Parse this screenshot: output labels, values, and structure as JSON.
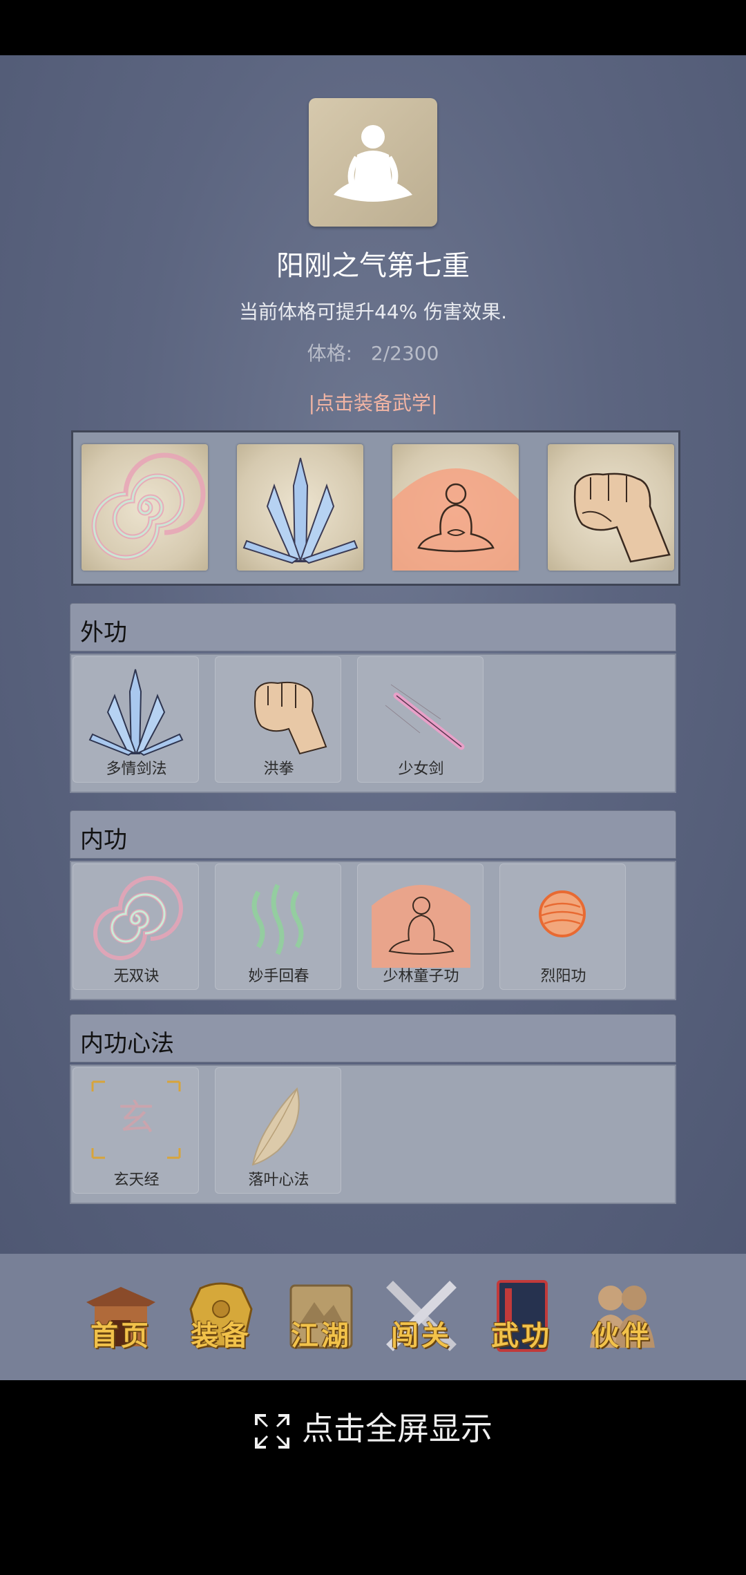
{
  "profile": {
    "title": "阳刚之气第七重",
    "description": "当前体格可提升44% 伤害效果.",
    "stat_label": "体格:",
    "stat_value": "2/2300",
    "equip_link": "|点击装备武学|"
  },
  "equipped_slots": [
    {
      "icon": "swirl-icon"
    },
    {
      "icon": "crystal-blades-icon"
    },
    {
      "icon": "meditating-monk-icon"
    },
    {
      "icon": "fist-icon"
    }
  ],
  "sections": [
    {
      "title": "外功",
      "items": [
        {
          "name": "多情剑法",
          "icon": "crystal-blades-icon"
        },
        {
          "name": "洪拳",
          "icon": "fist-icon"
        },
        {
          "name": "少女剑",
          "icon": "pink-sword-icon"
        }
      ]
    },
    {
      "title": "内功",
      "items": [
        {
          "name": "无双诀",
          "icon": "swirl-icon"
        },
        {
          "name": "妙手回春",
          "icon": "green-waves-icon"
        },
        {
          "name": "少林童子功",
          "icon": "meditating-monk-icon"
        },
        {
          "name": "烈阳功",
          "icon": "sun-orb-icon"
        }
      ]
    },
    {
      "title": "内功心法",
      "items": [
        {
          "name": "玄天经",
          "icon": "xuan-scroll-icon",
          "glyph": "玄"
        },
        {
          "name": "落叶心法",
          "icon": "leaf-icon"
        }
      ]
    }
  ],
  "nav": [
    {
      "label": "首页",
      "icon": "temple-icon"
    },
    {
      "label": "装备",
      "icon": "armor-icon"
    },
    {
      "label": "江湖",
      "icon": "scroll-map-icon"
    },
    {
      "label": "闯关",
      "icon": "crossed-swords-icon"
    },
    {
      "label": "武功",
      "icon": "book-icon"
    },
    {
      "label": "伙伴",
      "icon": "companions-icon"
    }
  ],
  "fullscreen": {
    "label": "点击全屏显示",
    "icon": "expand-icon"
  },
  "colors": {
    "background": "#5c6580",
    "accent_link": "#f3b5a4",
    "nav_text": "#f2c24a"
  }
}
